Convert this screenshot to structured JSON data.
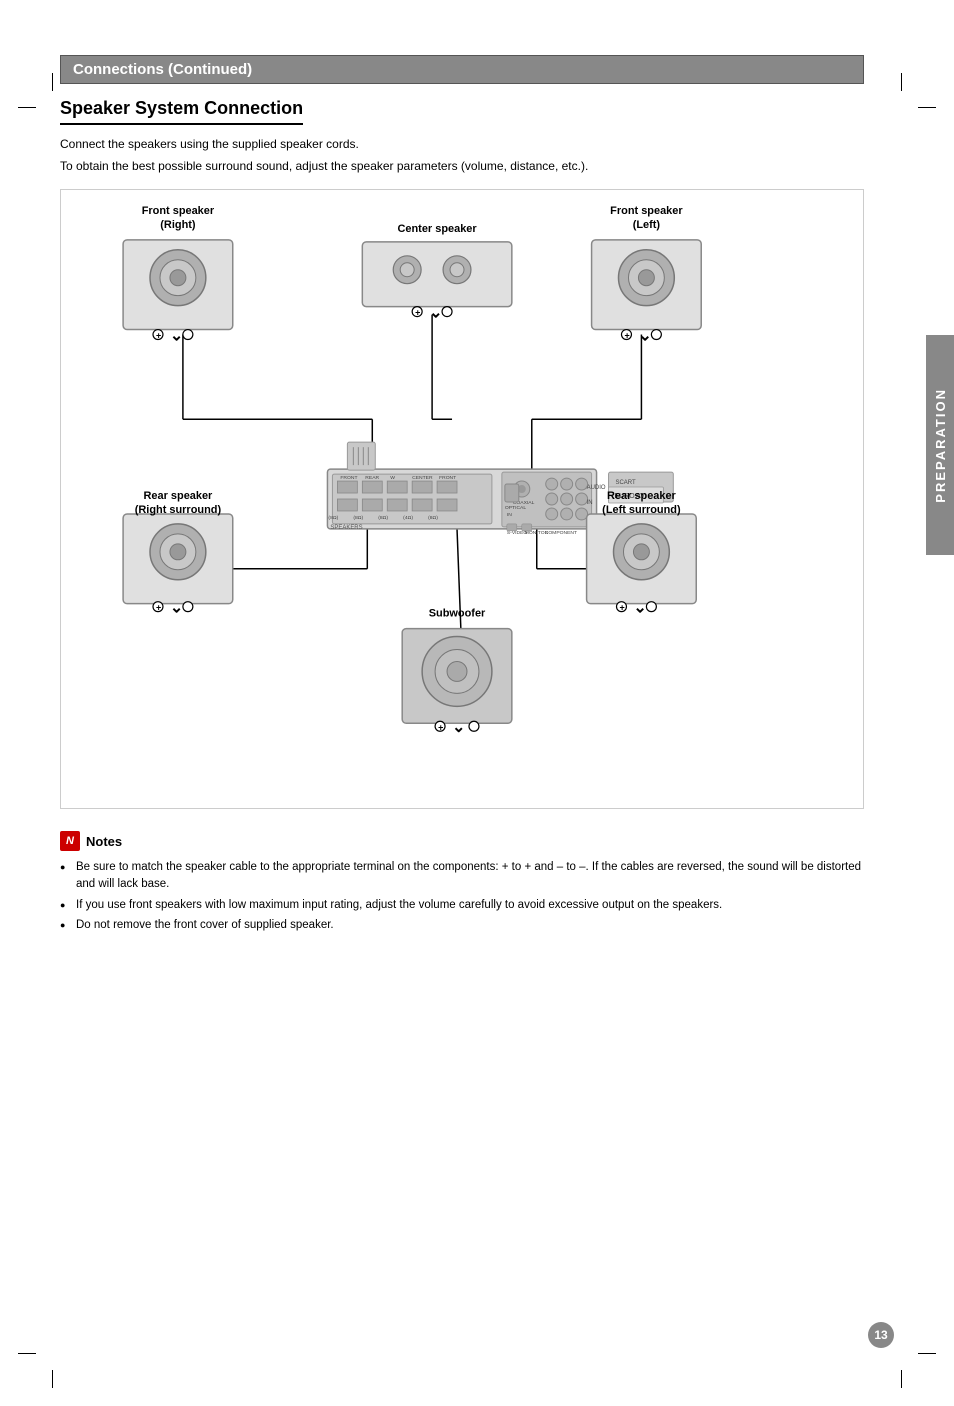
{
  "header": {
    "section_title": "Connections (Continued)"
  },
  "page": {
    "title": "Speaker System Connection",
    "intro1": "Connect the speakers using the supplied speaker cords.",
    "intro2": "To obtain the best possible surround sound, adjust the speaker parameters (volume, distance, etc.).",
    "side_tab": "PREPARATION",
    "page_number": "13"
  },
  "speakers": {
    "front_right_label": "Front speaker\n(Right)",
    "front_left_label": "Front speaker\n(Left)",
    "center_label": "Center speaker",
    "rear_right_label": "Rear speaker\n(Right surround)",
    "rear_left_label": "Rear speaker\n(Left surround)",
    "subwoofer_label": "Subwoofer"
  },
  "notes": {
    "header": "Notes",
    "items": [
      "Be sure to match the speaker cable to the appropriate terminal on the components: + to + and – to –. If the cables are reversed, the sound will be distorted  and will lack base.",
      "If you use front speakers with low maximum input rating, adjust the volume carefully to avoid excessive output on the speakers.",
      "Do not remove the front cover of supplied speaker."
    ]
  }
}
